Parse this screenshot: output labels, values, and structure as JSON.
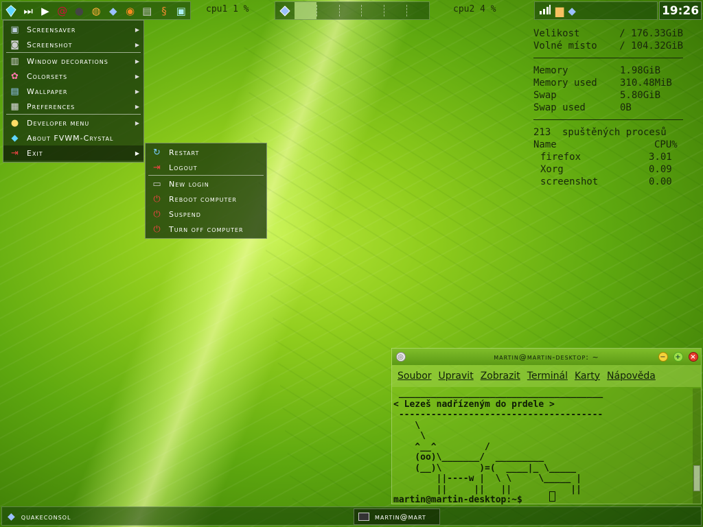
{
  "top_panel": {
    "launcher_icons": [
      "crystal-icon",
      "fast-forward-icon",
      "play-icon",
      "debian-icon",
      "mouse-icon",
      "browser-icon",
      "crystal-small-icon",
      "blender-icon",
      "files-icon",
      "seahorse-icon",
      "image-icon"
    ],
    "cpu1_label": "cpu1 1  %",
    "cpu2_label": "cpu2 4  %",
    "clock": "19:26"
  },
  "conky": {
    "disk": [
      {
        "label": "Velikost",
        "value": "/ 176.33GiB"
      },
      {
        "label": "Volné místo",
        "value": "/ 104.32GiB"
      }
    ],
    "memory": [
      {
        "label": "Memory",
        "value": "1.98GiB"
      },
      {
        "label": "Memory used",
        "value": "310.48MiB"
      },
      {
        "label": "Swap",
        "value": "5.80GiB"
      },
      {
        "label": "Swap used",
        "value": "0B"
      }
    ],
    "proc_count": "213",
    "proc_text": "spuštěných procesů",
    "proc_header_name": "Name",
    "proc_header_cpu": "CPU%",
    "processes": [
      {
        "name": "firefox",
        "cpu": "3.01"
      },
      {
        "name": "Xorg",
        "cpu": "0.09"
      },
      {
        "name": "screenshot",
        "cpu": "0.00"
      }
    ]
  },
  "main_menu": {
    "items": [
      {
        "label": "Screensaver",
        "icon": "screensaver-icon",
        "submenu": true
      },
      {
        "label": "Screenshot",
        "icon": "camera-icon",
        "submenu": true
      },
      {
        "label": "Window decorations",
        "icon": "window-decor-icon",
        "submenu": true
      },
      {
        "label": "Colorsets",
        "icon": "colorsets-icon",
        "submenu": true
      },
      {
        "label": "Wallpaper",
        "icon": "wallpaper-icon",
        "submenu": true
      },
      {
        "label": "Preferences",
        "icon": "preferences-icon",
        "submenu": true
      },
      {
        "label": "Developer menu",
        "icon": "developer-icon",
        "submenu": true
      },
      {
        "label": "About FVWM-Crystal",
        "icon": "crystal-icon",
        "submenu": false
      },
      {
        "label": "Exit",
        "icon": "exit-icon",
        "submenu": true
      }
    ]
  },
  "exit_menu": {
    "items": [
      {
        "label": "Restart",
        "icon": "restart-icon"
      },
      {
        "label": "Logout",
        "icon": "logout-icon"
      },
      {
        "label": "New login",
        "icon": "new-login-icon"
      },
      {
        "label": "Reboot computer",
        "icon": "reboot-icon"
      },
      {
        "label": "Suspend",
        "icon": "suspend-icon"
      },
      {
        "label": "Turn off computer",
        "icon": "power-off-icon"
      }
    ]
  },
  "terminal": {
    "title": "martin@martin-desktop: ~",
    "menus": [
      "Soubor",
      "Upravit",
      "Zobrazit",
      "Terminál",
      "Karty",
      "Nápověda"
    ],
    "content": " ______________________________________\n< Lezeš nadřízeným do prdele >\n --------------------------------------\n    \\\n     \\\n    ^__^         /\n    (oo)\\_______/  _________\n    (__)\\       )=(  ____|_ \\_____\n        ||----w |  \\ \\     \\_____ |\n        ||     ||   ||           ||\nmartin@martin-desktop:~$ "
  },
  "taskbar": {
    "tasks": [
      {
        "label": "quakeconsol",
        "icon": "crystal-icon",
        "active": false
      },
      {
        "label": "martin@mart",
        "icon": "terminal-icon",
        "active": true
      }
    ]
  },
  "colors": {
    "panel_bg": "#143c0a",
    "menu_bg": "#19370c",
    "conky_text": "#17260a"
  }
}
